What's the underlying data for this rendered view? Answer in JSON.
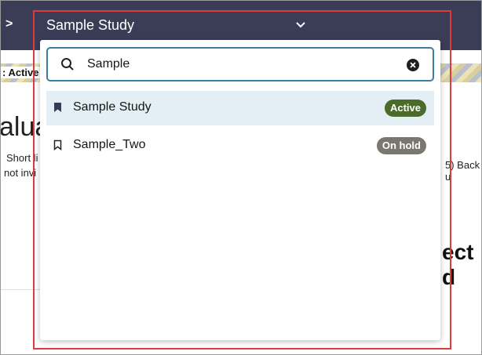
{
  "header": {
    "nav_glyph": ">",
    "study_title": "Sample Study"
  },
  "background": {
    "status_label": ": Active",
    "heading_fragment": "alua",
    "text_line_1": "Short li",
    "text_line_2": "not invi",
    "right_text": "5) Back u",
    "right_heading": "ect d"
  },
  "search": {
    "value": "Sample",
    "placeholder": ""
  },
  "results": [
    {
      "name": "Sample Study",
      "status": "Active",
      "status_color": "#4a6b2a",
      "selected": true,
      "bookmark": "filled"
    },
    {
      "name": "Sample_Two",
      "status": "On hold",
      "status_color": "#7a7670",
      "selected": false,
      "bookmark": "outline"
    }
  ],
  "colors": {
    "header_bg": "#3b3d57",
    "highlight_border": "#e0393e",
    "search_border": "#3c7ea0",
    "selected_row_bg": "#e4eff5"
  },
  "icons": {
    "search": "search-icon",
    "clear": "clear-icon",
    "caret": "chevron-down-icon",
    "bookmark_filled": "bookmark-filled-icon",
    "bookmark_outline": "bookmark-outline-icon"
  }
}
